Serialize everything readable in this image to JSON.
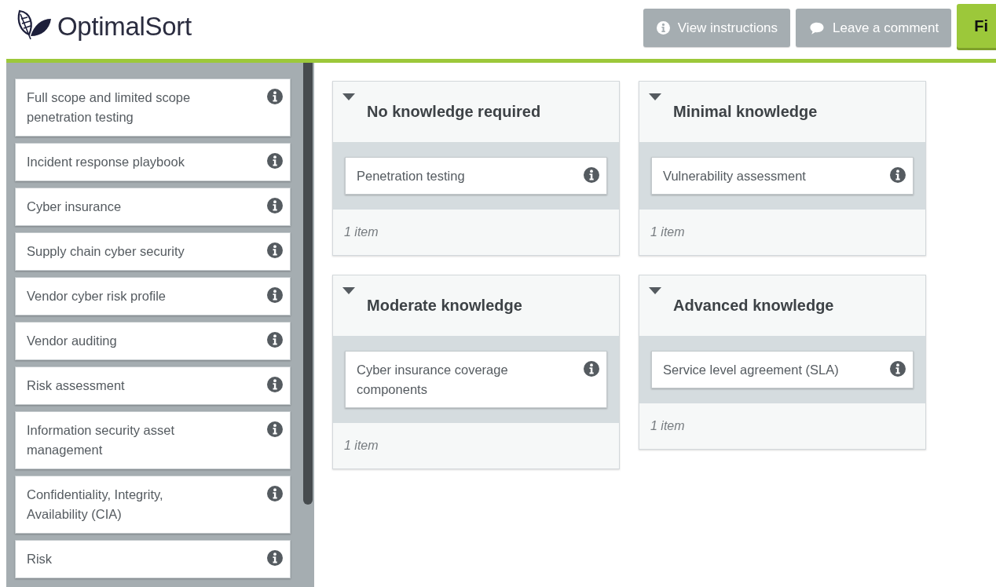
{
  "header": {
    "logo_text": "OptimalSort",
    "buttons": [
      {
        "kind": "info",
        "label": "View instructions"
      },
      {
        "kind": "comment",
        "label": "Leave a comment"
      },
      {
        "kind": "primary",
        "label": "Fi"
      }
    ]
  },
  "sidebar": {
    "cards": [
      {
        "label": "Full scope and limited scope penetration testing"
      },
      {
        "label": "Incident response playbook"
      },
      {
        "label": "Cyber insurance"
      },
      {
        "label": "Supply chain cyber security"
      },
      {
        "label": "Vendor cyber risk profile"
      },
      {
        "label": "Vendor auditing"
      },
      {
        "label": "Risk assessment"
      },
      {
        "label": "Information security asset management"
      },
      {
        "label": "Confidentiality, Integrity, Availability (CIA)"
      },
      {
        "label": "Risk"
      }
    ]
  },
  "groups": [
    {
      "title": "No knowledge required",
      "expanded": true,
      "cards": [
        {
          "label": "Penetration testing"
        }
      ],
      "count": "1 item"
    },
    {
      "title": "Minimal knowledge",
      "expanded": true,
      "cards": [
        {
          "label": "Vulnerability assessment"
        }
      ],
      "count": "1 item"
    },
    {
      "title": "Moderate knowledge",
      "expanded": true,
      "cards": [
        {
          "label": "Cyber insurance coverage components"
        }
      ],
      "count": "1 item"
    },
    {
      "title": "Advanced knowledge",
      "expanded": true,
      "cards": [
        {
          "label": "Service level agreement (SLA)"
        }
      ],
      "count": "1 item"
    }
  ]
}
